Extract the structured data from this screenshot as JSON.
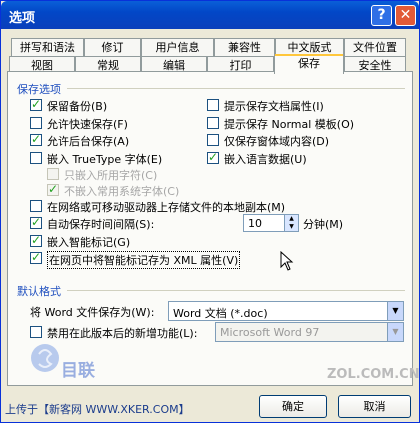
{
  "window": {
    "title": "选项"
  },
  "tabs_row1": [
    "拼写和语法",
    "修订",
    "用户信息",
    "兼容性",
    "中文版式",
    "文件位置"
  ],
  "tabs_row2": [
    "视图",
    "常规",
    "编辑",
    "打印",
    "保存",
    "安全性"
  ],
  "section1": "保存选项",
  "options": {
    "backup": "保留备份(B)",
    "fast_save": "允许快速保存(F)",
    "bg_save": "允许后台保存(A)",
    "embed_tt": "嵌入 TrueType 字体(E)",
    "embed_used": "只嵌入所用字符(C)",
    "no_common": "不嵌入常用系统字体(C)",
    "prompt_props": "提示保存文档属性(I)",
    "prompt_normal": "提示保存 Normal 模板(O)",
    "form_data": "仅保存窗体域内容(D)",
    "embed_lang": "嵌入语言数据(U)",
    "local_copy": "在网络或可移动驱动器上存储文件的本地副本(M)",
    "autosave": "自动保存时间间隔(S):",
    "smart_tags": "嵌入智能标记(G)",
    "xml_tags": "在网页中将智能标记存为 XML 属性(V)"
  },
  "autosave_value": "10",
  "autosave_unit": "分钟(M)",
  "section2": "默认格式",
  "format_label": "将 Word 文件保存为(W):",
  "format_value": "Word 文档 (*.doc)",
  "disable_label": "禁用在此版本后的新增功能(L):",
  "disable_value": "Microsoft Word 97",
  "buttons": {
    "ok": "确定",
    "cancel": "取消"
  },
  "footer": "上传于【新客网 WWW.XKER.COM】",
  "watermark": "ZOL.COM.CN",
  "icons": {
    "help": "help-icon",
    "close": "close-icon",
    "dropdown": "chevron-down-icon",
    "cursor": "mouse-pointer-icon"
  },
  "states": {
    "backup": true,
    "fast_save": false,
    "bg_save": true,
    "embed_tt": false,
    "embed_used": false,
    "no_common": true,
    "prompt_props": false,
    "prompt_normal": false,
    "form_data": false,
    "embed_lang": true,
    "local_copy": false,
    "autosave": true,
    "smart_tags": true,
    "xml_tags": true,
    "disable_features": false
  },
  "colors": {
    "title_bar": "#0a5fd8",
    "section_blue": "#1f4fbf",
    "check": "#21a121"
  }
}
